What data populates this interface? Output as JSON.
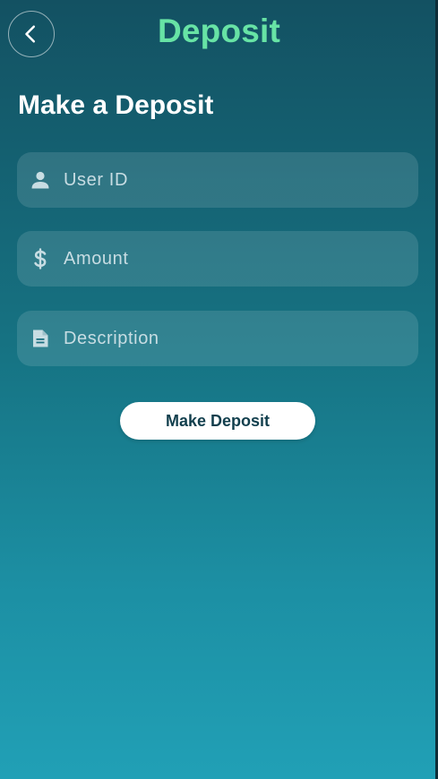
{
  "header": {
    "title": "Deposit",
    "back_icon": "chevron-left-icon"
  },
  "form": {
    "heading": "Make a Deposit",
    "fields": [
      {
        "icon": "person-icon",
        "placeholder": "User ID",
        "value": ""
      },
      {
        "icon": "dollar-icon",
        "placeholder": "Amount",
        "value": ""
      },
      {
        "icon": "document-icon",
        "placeholder": "Description",
        "value": ""
      }
    ],
    "submit_label": "Make Deposit"
  },
  "colors": {
    "title_accent": "#67e3a5",
    "gradient_top": "#135162",
    "gradient_bottom": "#21a0b6",
    "button_bg": "#ffffff",
    "button_text": "#123f4d",
    "icon": "#c8dde3"
  }
}
